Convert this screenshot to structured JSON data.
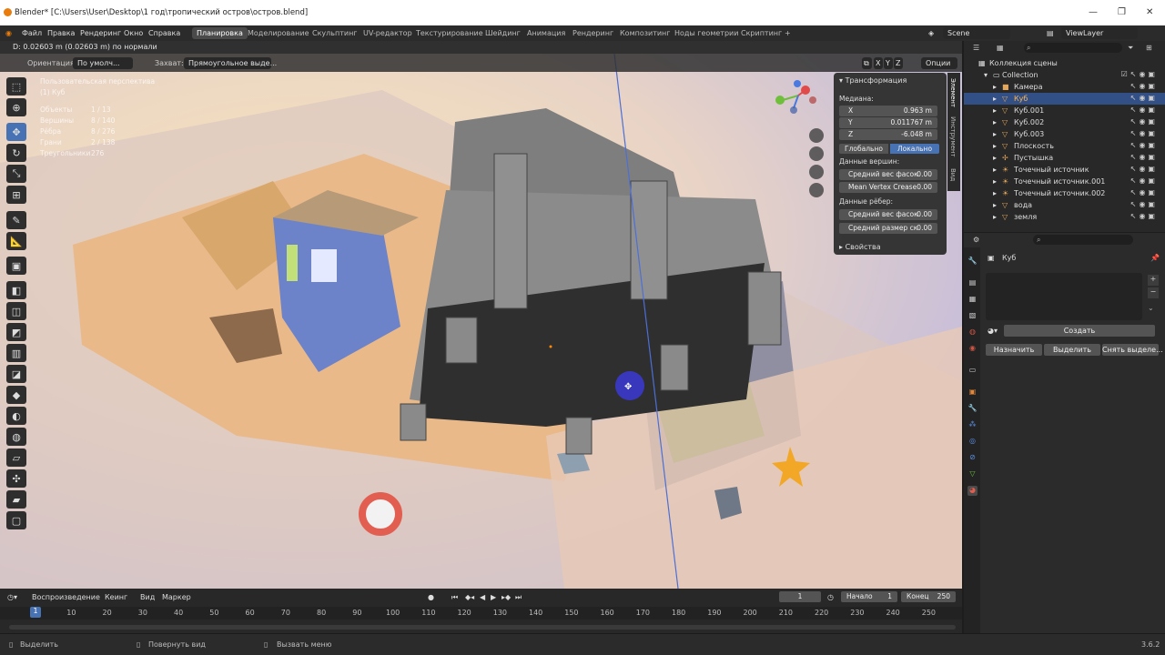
{
  "window": {
    "title": "Blender* [C:\\Users\\User\\Desktop\\1 год\\тропический остров\\остров.blend]",
    "min": "—",
    "max": "❐",
    "close": "✕"
  },
  "menu": {
    "items": [
      "Файл",
      "Правка",
      "Рендеринг",
      "Окно",
      "Справка"
    ],
    "workspaces": [
      "Планировка",
      "Моделирование",
      "Скульптинг",
      "UV-редактор",
      "Текстурирование",
      "Шейдинг",
      "Анимация",
      "Рендеринг",
      "Композитинг",
      "Ноды геометрии",
      "Скриптинг"
    ],
    "add": "+",
    "scene": "Scene",
    "view_layer": "ViewLayer"
  },
  "status_line": "D: 0.02603 m (0.02603 m) по нормали",
  "viewport_header": {
    "orientation_label": "Ориентация:",
    "orientation_value": "По умолч...",
    "snap_label": "Захват:",
    "snap_value": "Прямоугольное выде...",
    "axes": [
      "X",
      "Y",
      "Z"
    ],
    "options": "Опции"
  },
  "overlay_stats": {
    "view": "Пользовательская перспектива",
    "object": "(1) Куб",
    "rows": [
      {
        "k": "Объекты",
        "v": "1 / 13"
      },
      {
        "k": "Вершины",
        "v": "8 / 140"
      },
      {
        "k": "Рёбра",
        "v": "8 / 276"
      },
      {
        "k": "Грани",
        "v": "2 / 138"
      },
      {
        "k": "Треугольники",
        "v": "276"
      }
    ]
  },
  "n_panel": {
    "section": "Трансформация",
    "median": "Медиана:",
    "x_label": "X",
    "x_value": "0.963 m",
    "y_label": "Y",
    "y_value": "0.011767 m",
    "z_label": "Z",
    "z_value": "-6.048 m",
    "global": "Глобально",
    "local": "Локально",
    "vertex_data": "Данные вершин:",
    "bevel_weight_label": "Средний вес фасок",
    "bevel_weight_value": "0.00",
    "crease_label": "Mean Vertex Crease",
    "crease_value": "0.00",
    "edge_data": "Данные рёбер:",
    "edge_bevel_label": "Средний вес фасок",
    "edge_bevel_value": "0.00",
    "edge_size_label": "Средний размер ск",
    "edge_size_value": "0.00",
    "properties": "Свойства",
    "tabs": [
      "Элемент",
      "Инструмент",
      "Вид"
    ]
  },
  "outliner": {
    "search": "",
    "root": "Коллекция сцены",
    "collection": "Collection",
    "items": [
      {
        "name": "Камера",
        "icon": "camera-icon",
        "selected": false
      },
      {
        "name": "Куб",
        "icon": "mesh-icon",
        "selected": true
      },
      {
        "name": "Куб.001",
        "icon": "mesh-icon",
        "selected": false
      },
      {
        "name": "Куб.002",
        "icon": "mesh-icon",
        "selected": false
      },
      {
        "name": "Куб.003",
        "icon": "mesh-icon",
        "selected": false
      },
      {
        "name": "Плоскость",
        "icon": "mesh-icon",
        "selected": false
      },
      {
        "name": "Пустышка",
        "icon": "empty-icon",
        "selected": false
      },
      {
        "name": "Точечный источник",
        "icon": "light-icon",
        "selected": false
      },
      {
        "name": "Точечный источник.001",
        "icon": "light-icon",
        "selected": false
      },
      {
        "name": "Точечный источник.002",
        "icon": "light-icon",
        "selected": false
      },
      {
        "name": "вода",
        "icon": "mesh-icon",
        "selected": false
      },
      {
        "name": "земля",
        "icon": "mesh-icon",
        "selected": false
      }
    ]
  },
  "properties": {
    "object_name": "Куб",
    "create": "Создать",
    "assign": "Назначить",
    "select": "Выделить",
    "deselect": "Снять выделе..."
  },
  "timeline": {
    "playback": "Воспроизведение",
    "keying": "Кеинг",
    "view": "Вид",
    "marker": "Маркер",
    "current": "1",
    "start_label": "Начало",
    "start": "1",
    "end_label": "Конец",
    "end": "250",
    "ticks": [
      "10",
      "20",
      "30",
      "40",
      "50",
      "60",
      "70",
      "80",
      "90",
      "100",
      "110",
      "120",
      "130",
      "140",
      "150",
      "160",
      "170",
      "180",
      "190",
      "200",
      "210",
      "220",
      "230",
      "240",
      "250"
    ]
  },
  "footer": {
    "select": "Выделить",
    "rotate": "Повернуть вид",
    "menu": "Вызвать меню",
    "version": "3.6.2"
  },
  "colors": {
    "accent": "#4772b3",
    "selection": "#335086",
    "orange": "#e87d0d"
  }
}
